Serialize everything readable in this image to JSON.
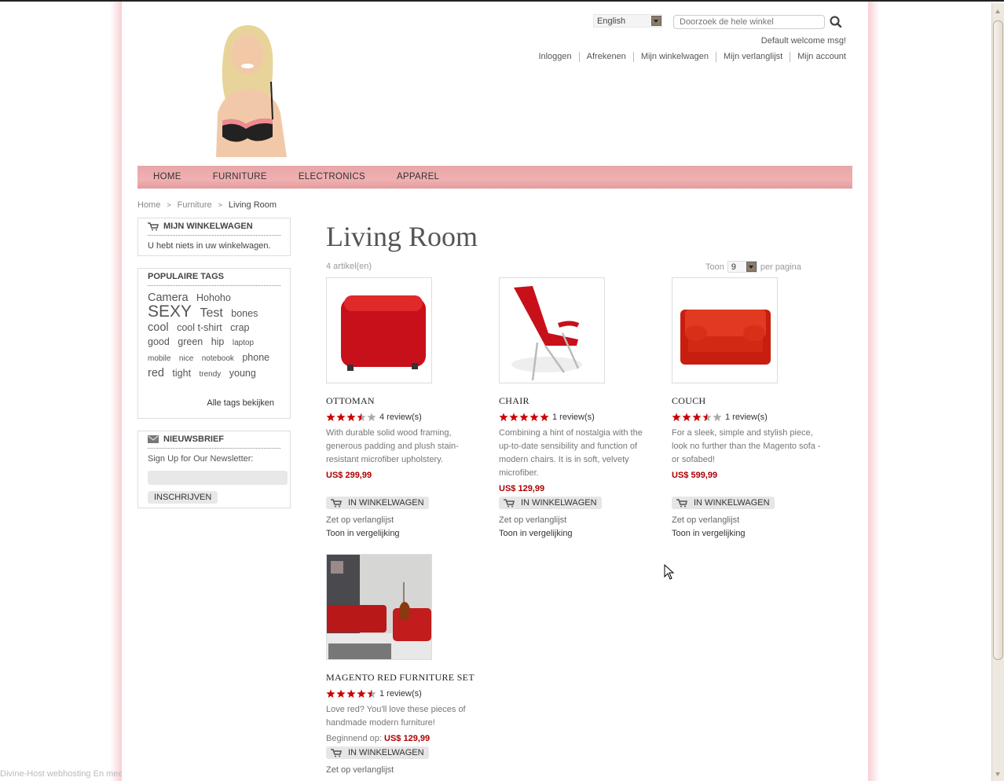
{
  "header": {
    "language": "English",
    "search_placeholder": "Doorzoek de hele winkel",
    "welcome": "Default welcome msg!",
    "links": [
      "Inloggen",
      "Afrekenen",
      "Mijn winkelwagen",
      "Mijn verlanglijst",
      "Mijn account"
    ]
  },
  "nav": [
    "HOME",
    "FURNITURE",
    "ELECTRONICS",
    "APPAREL"
  ],
  "breadcrumb": {
    "home": "Home",
    "parent": "Furniture",
    "current": "Living Room"
  },
  "sidebar": {
    "cart": {
      "title": "MIJN WINKELWAGEN",
      "empty": "U hebt niets in uw winkelwagen."
    },
    "tags": {
      "title": "POPULAIRE TAGS",
      "items": [
        {
          "label": "Camera",
          "size": "l"
        },
        {
          "label": "Hohoho",
          "size": "m"
        },
        {
          "label": "SEXY",
          "size": "xxl"
        },
        {
          "label": "Test",
          "size": "xl"
        },
        {
          "label": "bones",
          "size": "m"
        },
        {
          "label": "cool",
          "size": "l"
        },
        {
          "label": "cool t-shirt",
          "size": "m"
        },
        {
          "label": "crap",
          "size": "m"
        },
        {
          "label": "good",
          "size": "m"
        },
        {
          "label": "green",
          "size": "m"
        },
        {
          "label": "hip",
          "size": "m"
        },
        {
          "label": "laptop",
          "size": "s"
        },
        {
          "label": "mobile",
          "size": "s"
        },
        {
          "label": "nice",
          "size": "s"
        },
        {
          "label": "notebook",
          "size": "s"
        },
        {
          "label": "phone",
          "size": "m"
        },
        {
          "label": "red",
          "size": "l"
        },
        {
          "label": "tight",
          "size": "m"
        },
        {
          "label": "trendy",
          "size": "s"
        },
        {
          "label": "young",
          "size": "m"
        }
      ],
      "all_link": "Alle tags bekijken"
    },
    "newsletter": {
      "title": "NIEUWSBRIEF",
      "label": "Sign Up for Our Newsletter:",
      "input_value": "",
      "button": "INSCHRIJVEN"
    }
  },
  "main": {
    "title": "Living Room",
    "count": "4 artikel(en)",
    "toon_label": "Toon",
    "per_page": "9",
    "per_page_label": "per pagina",
    "products": [
      {
        "name": "OTTOMAN",
        "rating": 3.5,
        "reviews": "4 review(s)",
        "desc": "With durable solid wood framing, generous padding and plush stain-resistant microfiber upholstery.",
        "price_label": "",
        "price": "US$ 299,99",
        "cart": "IN WINKELWAGEN",
        "wishlist": "Zet op verlanglijst",
        "compare": "Toon in vergelijking"
      },
      {
        "name": "CHAIR",
        "rating": 5,
        "reviews": "1 review(s)",
        "desc": "Combining a hint of nostalgia with the up-to-date sensibility and function of modern chairs. It is in soft, velvety microfiber.",
        "price_label": "",
        "price": "US$ 129,99",
        "cart": "IN WINKELWAGEN",
        "wishlist": "Zet op verlanglijst",
        "compare": "Toon in vergelijking"
      },
      {
        "name": "COUCH",
        "rating": 3.5,
        "reviews": "1 review(s)",
        "desc": "For a sleek, simple and stylish piece, look no further than the Magento sofa - or sofabed!",
        "price_label": "",
        "price": "US$ 599,99",
        "cart": "IN WINKELWAGEN",
        "wishlist": "Zet op verlanglijst",
        "compare": "Toon in vergelijking"
      },
      {
        "name": "MAGENTO RED FURNITURE SET",
        "rating": 4.5,
        "reviews": "1 review(s)",
        "desc": "Love red? You'll love these pieces of handmade modern furniture!",
        "price_label": "Beginnend op: ",
        "price": "US$ 129,99",
        "cart": "IN WINKELWAGEN",
        "wishlist": "Zet op verlanglijst",
        "compare": ""
      }
    ]
  },
  "footer": {
    "text": "Divine-Host webhosting En meer."
  },
  "colors": {
    "nav": "#eeaaab",
    "price": "#aa0000",
    "star": "#cc0000",
    "star_empty": "#aaaaaa"
  }
}
